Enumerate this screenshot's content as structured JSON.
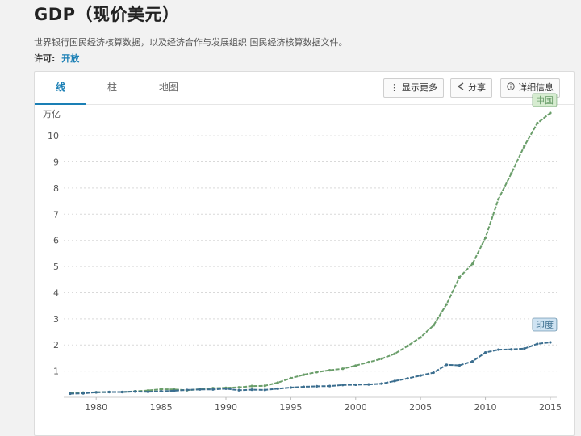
{
  "page": {
    "title": "GDP（现价美元）",
    "source": "世界银行国民经济核算数据，以及经济合作与发展组织 国民经济核算数据文件。",
    "license_label": "许可:",
    "license_value": "开放"
  },
  "tabs": [
    {
      "label": "线",
      "active": true
    },
    {
      "label": "柱",
      "active": false
    },
    {
      "label": "地图",
      "active": false
    }
  ],
  "toolbar": {
    "more_label": "显示更多",
    "share_label": "分享",
    "details_label": "详细信息",
    "more_icon": "vertical-dots-icon",
    "share_icon": "share-icon",
    "details_icon": "info-circle-icon"
  },
  "colors": {
    "china": "#6a9e6a",
    "india": "#3b6e8f",
    "grid": "#d9d9d9",
    "china_label_bg": "#d6ecd0",
    "india_label_bg": "#cfe3f2",
    "active_tab": "#1a7fb5"
  },
  "chart_data": {
    "type": "line",
    "unit_label": "万亿",
    "ylim": [
      0,
      11
    ],
    "yticks": [
      1,
      2,
      3,
      4,
      5,
      6,
      7,
      8,
      9,
      10
    ],
    "xlim": [
      1977.5,
      2015.5
    ],
    "xticks": [
      1980,
      1985,
      1990,
      1995,
      2000,
      2005,
      2010,
      2015
    ],
    "grid": true,
    "x": [
      1978,
      1979,
      1980,
      1981,
      1982,
      1983,
      1984,
      1985,
      1986,
      1987,
      1988,
      1989,
      1990,
      1991,
      1992,
      1993,
      1994,
      1995,
      1996,
      1997,
      1998,
      1999,
      2000,
      2001,
      2002,
      2003,
      2004,
      2005,
      2006,
      2007,
      2008,
      2009,
      2010,
      2011,
      2012,
      2013,
      2014,
      2015
    ],
    "series": [
      {
        "name": "中国",
        "color_key": "china",
        "values": [
          0.15,
          0.18,
          0.19,
          0.2,
          0.2,
          0.23,
          0.26,
          0.31,
          0.3,
          0.27,
          0.31,
          0.35,
          0.36,
          0.38,
          0.43,
          0.44,
          0.56,
          0.73,
          0.86,
          0.96,
          1.03,
          1.09,
          1.21,
          1.34,
          1.47,
          1.66,
          1.96,
          2.29,
          2.75,
          3.55,
          4.59,
          5.1,
          6.1,
          7.57,
          8.56,
          9.61,
          10.48,
          10.87
        ]
      },
      {
        "name": "印度",
        "color_key": "india",
        "values": [
          0.14,
          0.15,
          0.19,
          0.2,
          0.2,
          0.22,
          0.21,
          0.23,
          0.25,
          0.28,
          0.3,
          0.3,
          0.33,
          0.27,
          0.29,
          0.28,
          0.33,
          0.37,
          0.4,
          0.42,
          0.43,
          0.47,
          0.48,
          0.49,
          0.52,
          0.62,
          0.72,
          0.83,
          0.94,
          1.24,
          1.22,
          1.37,
          1.71,
          1.82,
          1.83,
          1.86,
          2.04,
          2.1
        ]
      }
    ]
  }
}
